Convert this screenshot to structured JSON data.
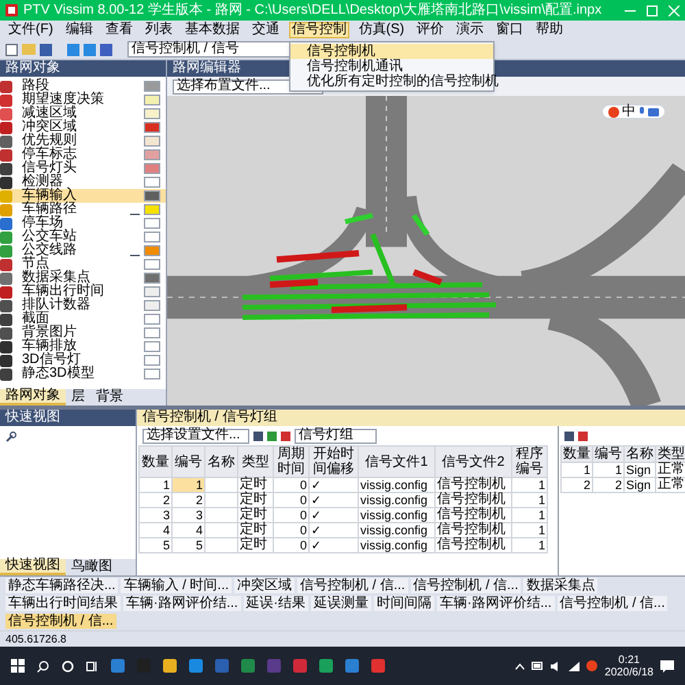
{
  "window": {
    "title": "PTV Vissim 8.00-12 学生版本 - 路网 - C:\\Users\\DELL\\Desktop\\大雁塔南北路口\\vissim\\配置.inpx"
  },
  "menu": [
    {
      "label": "文件(F)",
      "open": false
    },
    {
      "label": "编辑",
      "open": false
    },
    {
      "label": "查看",
      "open": false
    },
    {
      "label": "列表",
      "open": false
    },
    {
      "label": "基本数据",
      "open": false
    },
    {
      "label": "交通",
      "open": false
    },
    {
      "label": "信号控制",
      "open": true
    },
    {
      "label": "仿真(S)",
      "open": false
    },
    {
      "label": "评价",
      "open": false
    },
    {
      "label": "演示",
      "open": false
    },
    {
      "label": "窗口",
      "open": false
    },
    {
      "label": "帮助",
      "open": false
    }
  ],
  "dropdown": [
    {
      "label": "信号控制机",
      "selected": true
    },
    {
      "label": "信号控制机通讯",
      "selected": false
    },
    {
      "label": "优化所有定时控制的信号控制机",
      "selected": false
    }
  ],
  "toolbar": {
    "field": "信号控制机 / 信号"
  },
  "left_panel": {
    "title": "路网对象",
    "items": [
      {
        "label": "路段",
        "selected": false,
        "color": "#9a9a9a",
        "text_toggle": false
      },
      {
        "label": "期望速度决策",
        "selected": false,
        "color": "#f4f0b0",
        "text_toggle": false
      },
      {
        "label": "减速区域",
        "selected": false,
        "color": "#f6f1c8",
        "text_toggle": false
      },
      {
        "label": "冲突区域",
        "selected": false,
        "color": "#d83020",
        "text_toggle": false
      },
      {
        "label": "优先规则",
        "selected": false,
        "color": "#f3e6d0",
        "text_toggle": false
      },
      {
        "label": "停车标志",
        "selected": false,
        "color": "#e0a0a0",
        "text_toggle": false
      },
      {
        "label": "信号灯头",
        "selected": false,
        "color": "#e08080",
        "text_toggle": false
      },
      {
        "label": "检测器",
        "selected": false,
        "color": "#ffffff",
        "text_toggle": false
      },
      {
        "label": "车辆输入",
        "selected": true,
        "color": "#606060",
        "text_toggle": false
      },
      {
        "label": "车辆路径",
        "selected": false,
        "color": "#f5e000",
        "text_toggle": true
      },
      {
        "label": "停车场",
        "selected": false,
        "color": "#ffffff",
        "text_toggle": false
      },
      {
        "label": "公交车站",
        "selected": false,
        "color": "#ffffff",
        "text_toggle": false
      },
      {
        "label": "公交线路",
        "selected": false,
        "color": "#f08c00",
        "text_toggle": true
      },
      {
        "label": "节点",
        "selected": false,
        "color": "#ffffff",
        "text_toggle": false
      },
      {
        "label": "数据采集点",
        "selected": false,
        "color": "#707070",
        "text_toggle": false
      },
      {
        "label": "车辆出行时间",
        "selected": false,
        "color": "#eeeeee",
        "text_toggle": false
      },
      {
        "label": "排队计数器",
        "selected": false,
        "color": "#eeeeee",
        "text_toggle": false
      },
      {
        "label": "截面",
        "selected": false,
        "color": "#ffffff",
        "text_toggle": false
      },
      {
        "label": "背景图片",
        "selected": false,
        "color": "#ffffff",
        "text_toggle": false
      },
      {
        "label": "车辆排放",
        "selected": false,
        "color": "#ffffff",
        "text_toggle": false
      },
      {
        "label": "3D信号灯",
        "selected": false,
        "color": "#ffffff",
        "text_toggle": false
      },
      {
        "label": "静态3D模型",
        "selected": false,
        "color": "#ffffff",
        "text_toggle": false
      }
    ],
    "tabs": [
      {
        "label": "路网对象",
        "selected": true
      },
      {
        "label": "层",
        "selected": false
      },
      {
        "label": "背景",
        "selected": false
      }
    ]
  },
  "editor": {
    "title": "路网编辑器",
    "layout_field": "选择布置文件...",
    "ime_label": "中"
  },
  "quick_view": {
    "title": "快速视图",
    "tabs": [
      {
        "label": "快速视图",
        "selected": true
      },
      {
        "label": "鸟瞰图",
        "selected": false
      }
    ]
  },
  "signal_panel": {
    "title": "信号控制机 / 信号灯组",
    "layout_field": "选择设置文件...",
    "list_field": "信号灯组",
    "controllers": {
      "columns": [
        "数量",
        "编号",
        "名称",
        "类型",
        "周期时间",
        "开始时间偏移",
        "信号文件1",
        "信号文件2",
        "程序编号"
      ],
      "rows": [
        {
          "selected": true,
          "cells": [
            "1",
            "1",
            "",
            "定时",
            "0",
            "✓",
            "vissig.config",
            "信号控制机",
            "1"
          ]
        },
        {
          "selected": false,
          "cells": [
            "2",
            "2",
            "",
            "定时",
            "0",
            "✓",
            "vissig.config",
            "信号控制机",
            "1"
          ]
        },
        {
          "selected": false,
          "cells": [
            "3",
            "3",
            "",
            "定时",
            "0",
            "✓",
            "vissig.config",
            "信号控制机",
            "1"
          ]
        },
        {
          "selected": false,
          "cells": [
            "4",
            "4",
            "",
            "定时",
            "0",
            "✓",
            "vissig.config",
            "信号控制机",
            "1"
          ]
        },
        {
          "selected": false,
          "cells": [
            "5",
            "5",
            "",
            "定时",
            "0",
            "✓",
            "vissig.config",
            "信号控制机",
            "1"
          ]
        }
      ]
    },
    "groups": {
      "columns": [
        "数量",
        "编号",
        "名称",
        "类型"
      ],
      "rows": [
        {
          "selected": false,
          "cells": [
            "1",
            "1",
            "Sign",
            "正常"
          ]
        },
        {
          "selected": false,
          "cells": [
            "2",
            "2",
            "Sign",
            "正常"
          ]
        }
      ]
    }
  },
  "bottom_tabs": [
    {
      "label": "静态车辆路径决...",
      "selected": false
    },
    {
      "label": "车辆输入 / 时间...",
      "selected": false
    },
    {
      "label": "冲突区域",
      "selected": false
    },
    {
      "label": "信号控制机 / 信...",
      "selected": false
    },
    {
      "label": "信号控制机 / 信...",
      "selected": false
    },
    {
      "label": "数据采集点",
      "selected": false
    },
    {
      "label": "车辆出行时间结果",
      "selected": false
    },
    {
      "label": "车辆·路网评价结...",
      "selected": false
    },
    {
      "label": "延误·结果",
      "selected": false
    },
    {
      "label": "延误测量",
      "selected": false
    },
    {
      "label": "时间间隔",
      "selected": false
    },
    {
      "label": "车辆·路网评价结...",
      "selected": false
    },
    {
      "label": "信号控制机 / 信...",
      "selected": false
    },
    {
      "label": "信号控制机 / 信...",
      "selected": true
    }
  ],
  "status_bar": "405.61726.8",
  "taskbar": {
    "time": "0:21",
    "date": "2020/6/18"
  }
}
